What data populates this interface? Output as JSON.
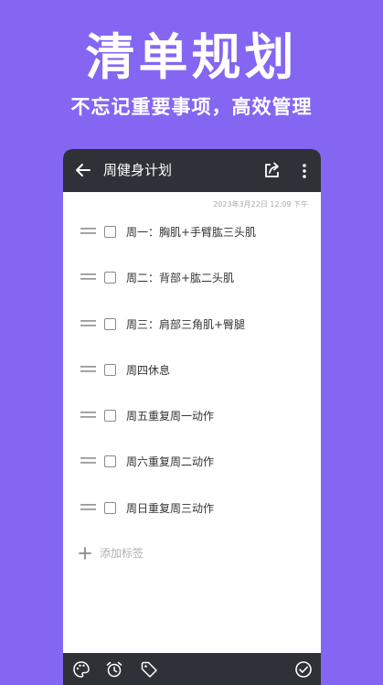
{
  "hero": {
    "title": "清单规划",
    "subtitle": "不忘记重要事项，高效管理"
  },
  "appbar": {
    "title": "周健身计划",
    "icons": [
      "back-arrow-icon",
      "share-icon",
      "more-vert-icon"
    ]
  },
  "note": {
    "timestamp": "2023年3月22日 12:09 下午",
    "items": [
      {
        "label": "周一：胸肌+手臂肱三头肌",
        "checked": false
      },
      {
        "label": "周二：背部+肱二头肌",
        "checked": false
      },
      {
        "label": "周三：肩部三角肌+臀腿",
        "checked": false
      },
      {
        "label": "周四休息",
        "checked": false
      },
      {
        "label": "周五重复周一动作",
        "checked": false
      },
      {
        "label": "周六重复周二动作",
        "checked": false
      },
      {
        "label": "周日重复周三动作",
        "checked": false
      }
    ],
    "add_tag_label": "添加标签"
  },
  "bottombar": {
    "icons": [
      "palette-icon",
      "alarm-icon",
      "tag-icon",
      "check-circle-icon"
    ]
  },
  "colors": {
    "background": "#8466f3",
    "appbar": "#2e3138",
    "text": "#333333",
    "muted": "#b0b0b0"
  }
}
